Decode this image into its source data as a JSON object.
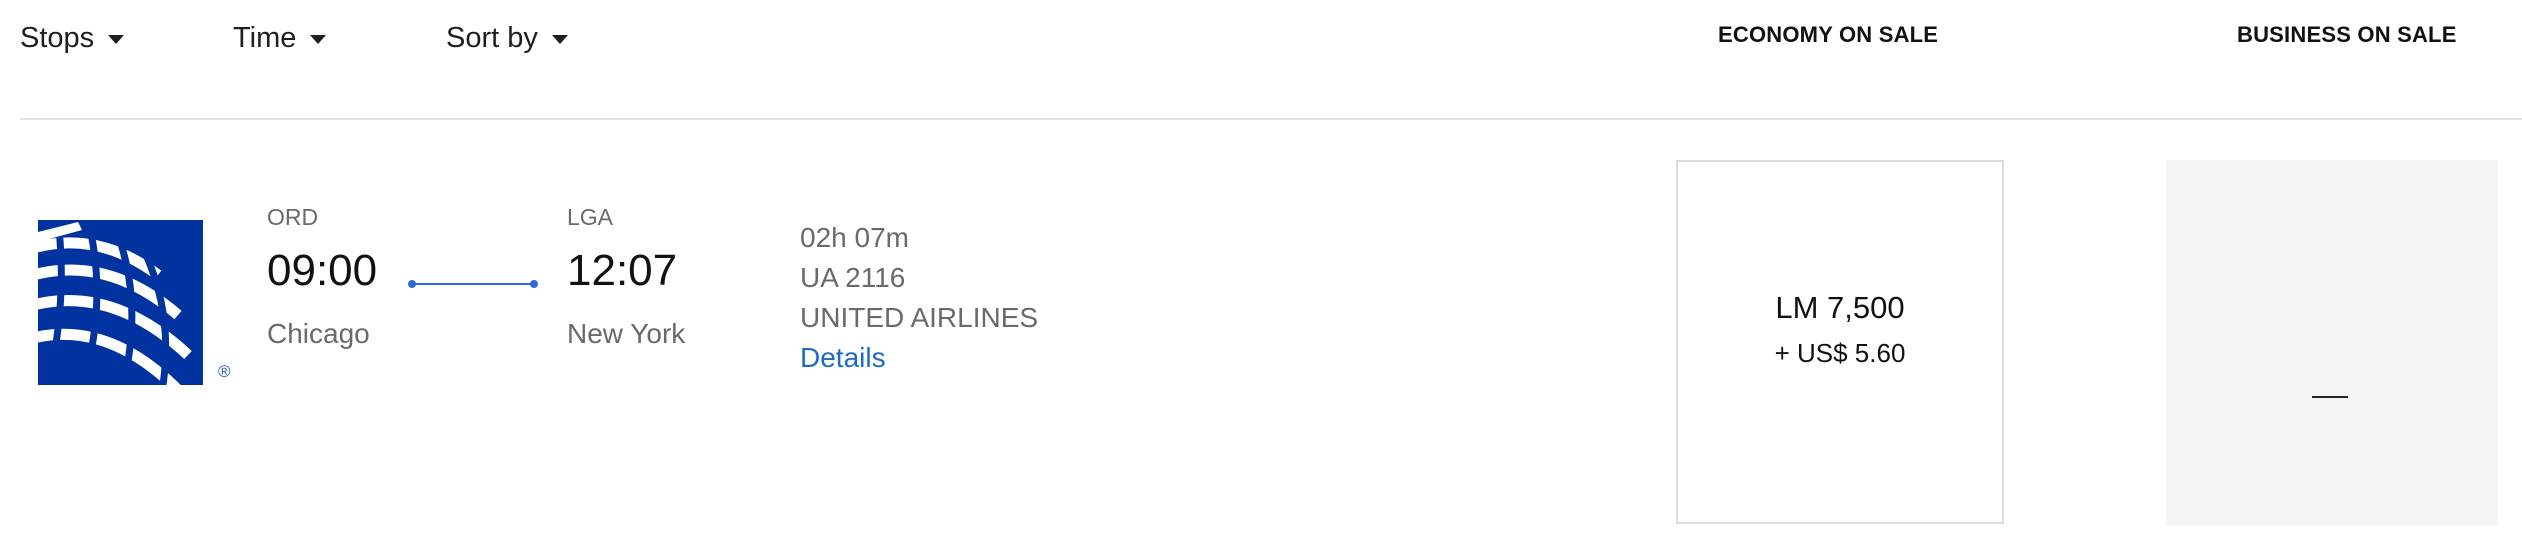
{
  "filters": {
    "stops_label": "Stops",
    "time_label": "Time",
    "sort_label": "Sort by"
  },
  "columns": {
    "economy_header": "ECONOMY ON SALE",
    "business_header": "BUSINESS ON SALE"
  },
  "flight": {
    "airline_logo": "united-globe-logo",
    "registered_mark": "®",
    "departure": {
      "code": "ORD",
      "time": "09:00",
      "city": "Chicago"
    },
    "arrival": {
      "code": "LGA",
      "time": "12:07",
      "city": "New York"
    },
    "duration": "02h 07m",
    "flight_number": "UA 2116",
    "airline_name": "UNITED AIRLINES",
    "details_label": "Details"
  },
  "fares": {
    "economy_points": "LM 7,500",
    "economy_cash": "+ US$ 5.60",
    "business_value": "—"
  },
  "colors": {
    "brand_blue": "#0033a0",
    "link_blue": "#1e6bc4",
    "route_blue": "#2a6cd3"
  }
}
